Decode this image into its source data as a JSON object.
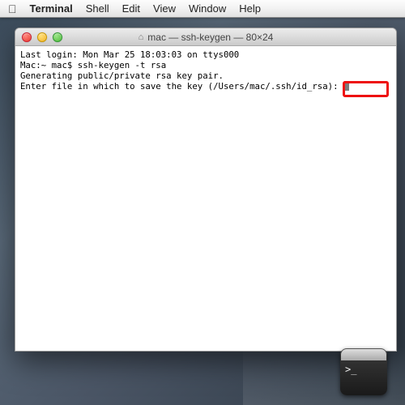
{
  "menubar": {
    "apple": "",
    "app": "Terminal",
    "items": [
      "Shell",
      "Edit",
      "View",
      "Window",
      "Help"
    ]
  },
  "window": {
    "title": "mac — ssh-keygen — 80×24",
    "home_glyph": "⌂"
  },
  "terminal": {
    "line1": "Last login: Mon Mar 25 18:03:03 on ttys000",
    "line2": "Mac:~ mac$ ssh-keygen -t rsa",
    "line3": "Generating public/private rsa key pair.",
    "line4": "Enter file in which to save the key (/Users/mac/.ssh/id_rsa): "
  },
  "dock": {
    "prompt": ">_"
  }
}
